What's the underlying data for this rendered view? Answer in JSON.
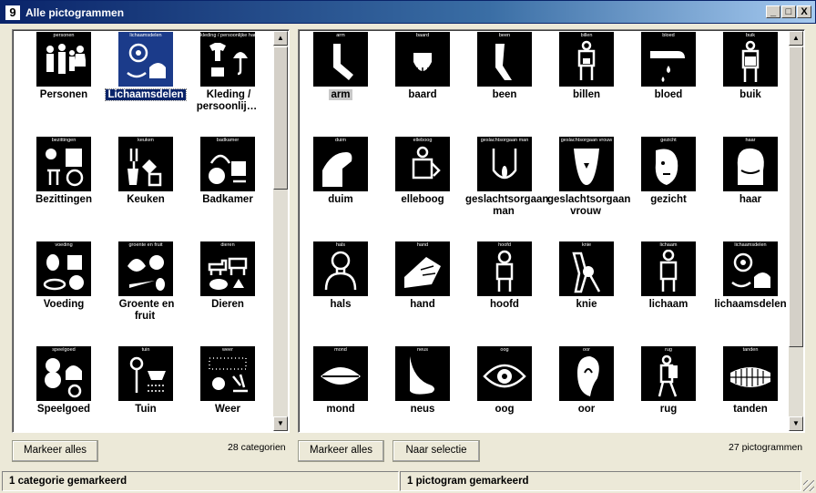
{
  "window": {
    "title": "Alle pictogrammen",
    "app_icon": "9",
    "controls": {
      "minimize": "_",
      "maximize": "□",
      "close": "X"
    }
  },
  "categories": {
    "items": [
      {
        "label": "Personen",
        "caption": "personen",
        "icon": "people-icon"
      },
      {
        "label": "Lichaamsdelen",
        "caption": "lichaamsdelen",
        "icon": "body-parts-icon",
        "selected": true
      },
      {
        "label": "Kleding / persoonlij…",
        "caption": "kleding / persoonlijke handtas",
        "icon": "clothing-icon"
      },
      {
        "label": "Bezittingen",
        "caption": "bezittingen",
        "icon": "belongings-icon"
      },
      {
        "label": "Keuken",
        "caption": "keuken",
        "icon": "kitchen-icon"
      },
      {
        "label": "Badkamer",
        "caption": "badkamer",
        "icon": "bathroom-icon"
      },
      {
        "label": "Voeding",
        "caption": "voeding",
        "icon": "food-icon"
      },
      {
        "label": "Groente en fruit",
        "caption": "groente en fruit",
        "icon": "vegetables-icon"
      },
      {
        "label": "Dieren",
        "caption": "dieren",
        "icon": "animals-icon"
      },
      {
        "label": "Speelgoed",
        "caption": "speelgoed",
        "icon": "toys-icon"
      },
      {
        "label": "Tuin",
        "caption": "tuin",
        "icon": "garden-icon"
      },
      {
        "label": "Weer",
        "caption": "weer",
        "icon": "weather-icon"
      }
    ],
    "count_text": "28 categorien",
    "mark_all_label": "Markeer alles"
  },
  "pictograms": {
    "items": [
      {
        "label": "arm",
        "caption": "arm",
        "icon": "arm-icon",
        "selected": true
      },
      {
        "label": "baard",
        "caption": "baard",
        "icon": "beard-icon"
      },
      {
        "label": "been",
        "caption": "been",
        "icon": "leg-icon"
      },
      {
        "label": "billen",
        "caption": "billen",
        "icon": "buttocks-icon"
      },
      {
        "label": "bloed",
        "caption": "bloed",
        "icon": "blood-icon"
      },
      {
        "label": "buik",
        "caption": "buik",
        "icon": "belly-icon"
      },
      {
        "label": "duim",
        "caption": "duim",
        "icon": "thumb-icon"
      },
      {
        "label": "elleboog",
        "caption": "elleboog",
        "icon": "elbow-icon"
      },
      {
        "label": "geslachtsorgaan man",
        "caption": "geslachtsorgaan man",
        "icon": "male-genitals-icon"
      },
      {
        "label": "geslachtsorgaan vrouw",
        "caption": "geslachtsorgaan vrouw",
        "icon": "female-genitals-icon"
      },
      {
        "label": "gezicht",
        "caption": "gezicht",
        "icon": "face-icon"
      },
      {
        "label": "haar",
        "caption": "haar",
        "icon": "hair-icon"
      },
      {
        "label": "hals",
        "caption": "hals",
        "icon": "neck-icon"
      },
      {
        "label": "hand",
        "caption": "hand",
        "icon": "hand-icon"
      },
      {
        "label": "hoofd",
        "caption": "hoofd",
        "icon": "head-icon"
      },
      {
        "label": "knie",
        "caption": "knie",
        "icon": "knee-icon"
      },
      {
        "label": "lichaam",
        "caption": "lichaam",
        "icon": "body-icon"
      },
      {
        "label": "lichaamsdelen",
        "caption": "lichaamsdelen",
        "icon": "body-parts-icon"
      },
      {
        "label": "mond",
        "caption": "mond",
        "icon": "mouth-icon"
      },
      {
        "label": "neus",
        "caption": "neus",
        "icon": "nose-icon"
      },
      {
        "label": "oog",
        "caption": "oog",
        "icon": "eye-icon"
      },
      {
        "label": "oor",
        "caption": "oor",
        "icon": "ear-icon"
      },
      {
        "label": "rug",
        "caption": "rug",
        "icon": "back-icon"
      },
      {
        "label": "tanden",
        "caption": "tanden",
        "icon": "teeth-icon"
      }
    ],
    "count_text": "27 pictogrammen",
    "mark_all_label": "Markeer alles",
    "to_selection_label": "Naar selectie"
  },
  "status": {
    "left": "1 categorie gemarkeerd",
    "right": "1 pictogram gemarkeerd"
  },
  "colors": {
    "title_bar": "#0a246a",
    "selected_label": "#0a246a",
    "tile_background": "#000000"
  }
}
